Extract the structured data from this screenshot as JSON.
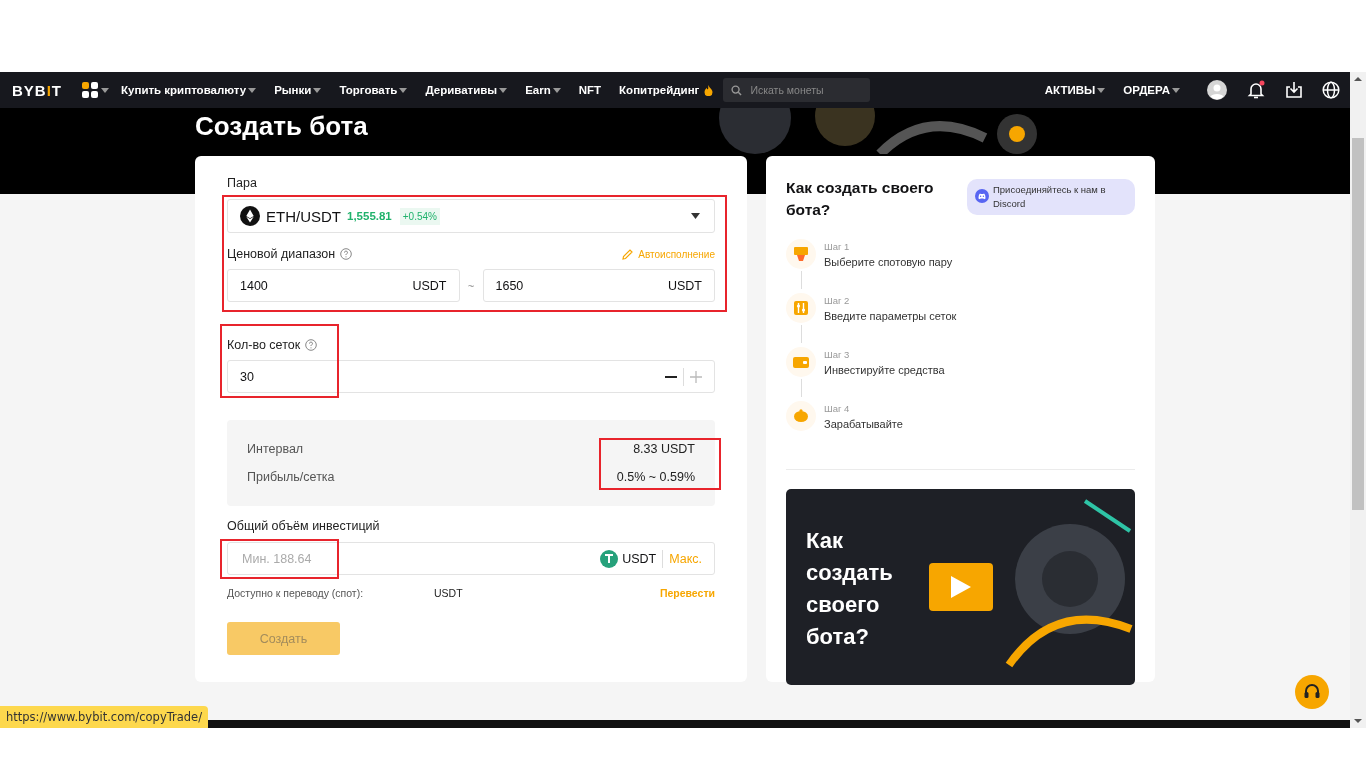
{
  "nav": {
    "logo": {
      "before": "BYB",
      "accent": "I",
      "after": "T"
    },
    "menu": [
      {
        "label": "Купить криптовалюту",
        "dropdown": true,
        "hot": false
      },
      {
        "label": "Рынки",
        "dropdown": true,
        "hot": false
      },
      {
        "label": "Торговать",
        "dropdown": true,
        "hot": false
      },
      {
        "label": "Деривативы",
        "dropdown": true,
        "hot": false
      },
      {
        "label": "Earn",
        "dropdown": true,
        "hot": false
      },
      {
        "label": "NFT",
        "dropdown": false,
        "hot": false
      },
      {
        "label": "Копитрейдинг",
        "dropdown": false,
        "hot": true
      }
    ],
    "search": {
      "placeholder": "Искать монеты"
    },
    "right_menu": [
      {
        "label": "АКТИВЫ",
        "dropdown": true
      },
      {
        "label": "ОРДЕРА",
        "dropdown": true
      }
    ],
    "notification": true
  },
  "page_title": "Создать бота",
  "form": {
    "pair": {
      "label": "Пара",
      "symbol": "ETH/USDT",
      "price": "1,555.81",
      "change": "+0.54%",
      "highlighted": true
    },
    "price_range": {
      "label": "Ценовой диапазон",
      "autofill": "Автоисполнение",
      "min": {
        "value": "1400",
        "unit": "USDT"
      },
      "separator": "~",
      "max": {
        "value": "1650",
        "unit": "USDT"
      }
    },
    "grids": {
      "label": "Кол-во сеток",
      "value": "30",
      "highlighted": true
    },
    "summary": {
      "highlighted": true,
      "rows": [
        {
          "label": "Интервал",
          "value": "8.33 USDT"
        },
        {
          "label": "Прибыль/сетка",
          "value": "0.5% ~ 0.59%"
        }
      ]
    },
    "investment": {
      "label": "Общий объём инвестиций",
      "placeholder": "Мин. 188.64",
      "unit": "USDT",
      "max": "Макс.",
      "highlighted": true
    },
    "available": {
      "label": "Доступно к переводу (спот):",
      "value": "USDT",
      "link": "Перевести"
    },
    "create_button": {
      "label": "Создать",
      "disabled": true
    }
  },
  "guide": {
    "title": "Как создать своего бота?",
    "discord": "Присоединяйтесь к нам в Discord",
    "steps": [
      {
        "kind": "pair",
        "step": "Шаг 1",
        "text": "Выберите спотовую пару"
      },
      {
        "kind": "params",
        "step": "Шаг 2",
        "text": "Введите параметры сеток"
      },
      {
        "kind": "wallet",
        "step": "Шаг 3",
        "text": "Инвестируйте средства"
      },
      {
        "kind": "piggy",
        "step": "Шаг 4",
        "text": "Зарабатывайте"
      }
    ],
    "video": {
      "title": "Как создать своего бота?"
    }
  },
  "status_url": "https://www.bybit.com/copyTrade/"
}
